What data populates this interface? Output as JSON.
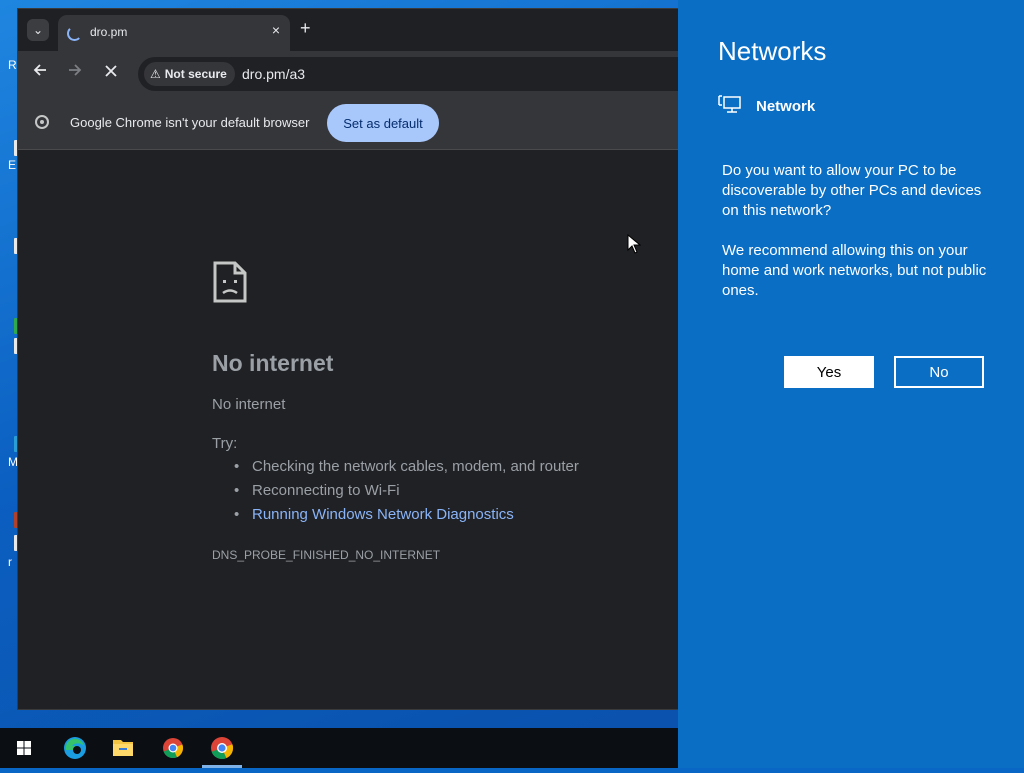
{
  "desktop": {
    "fragments": [
      "R",
      "E",
      "M",
      "r"
    ]
  },
  "browser": {
    "tab_title": "dro.pm",
    "tab_close": "×",
    "new_tab": "+",
    "tab_dropdown": "⌄",
    "security_chip": "Not secure",
    "url": "dro.pm/a3",
    "infobar": {
      "text": "Google Chrome isn't your default browser",
      "button": "Set as default"
    },
    "error": {
      "title": "No internet",
      "subtitle": "No internet",
      "try_label": "Try:",
      "suggestions": [
        "Checking the network cables, modem, and router",
        "Reconnecting to Wi-Fi",
        "Running Windows Network Diagnostics"
      ],
      "code": "DNS_PROBE_FINISHED_NO_INTERNET"
    }
  },
  "flyout": {
    "title": "Networks",
    "network_name": "Network",
    "question": "Do you want to allow your PC to be discoverable by other PCs and devices on this network?",
    "recommendation": "We recommend allowing this on your home and work networks, but not public ones.",
    "yes_label": "Yes",
    "no_label": "No"
  },
  "taskbar": {
    "items": [
      "start",
      "edge",
      "file-explorer",
      "chrome",
      "chrome-active"
    ]
  },
  "colors": {
    "flyout_bg": "#0a6ec4",
    "link": "#8ab4f8",
    "set_default_bg": "#a8c7fa",
    "page_bg": "#202124"
  }
}
